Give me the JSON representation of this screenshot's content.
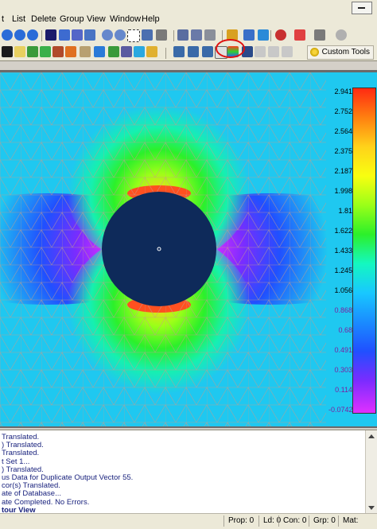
{
  "menu": {
    "items": [
      {
        "label": "t",
        "id": "t"
      },
      {
        "label": "List",
        "id": "list"
      },
      {
        "label": "Delete",
        "id": "delete"
      },
      {
        "label": "Group",
        "id": "group"
      },
      {
        "label": "View",
        "id": "view"
      },
      {
        "label": "Window",
        "id": "window"
      },
      {
        "label": "Help",
        "id": "help"
      }
    ]
  },
  "toolbar": {
    "custom_tools_label": "Custom Tools"
  },
  "legend": {
    "values": [
      "2.941",
      "2.752",
      "2.564",
      "2.375",
      "2.187",
      "1.998",
      "1.81",
      "1.622",
      "1.433",
      "1.245",
      "1.056",
      "0.868",
      "0.68",
      "0.491",
      "0.303",
      "0.114",
      "-0.0742"
    ]
  },
  "messages": [
    "Translated.",
    ") Translated.",
    "Translated.",
    "t Set 1...",
    ") Translated.",
    "us Data for Duplicate Output Vector 55.",
    "cor(s) Translated.",
    "ate of Database...",
    "ate Completed. No Errors.",
    "tour View"
  ],
  "status": {
    "prop": "Prop: 0",
    "ld": "Ld: 0",
    "con": "Con: 0",
    "grp": "Grp: 0",
    "mat": "Mat:"
  },
  "colors": {
    "background_field": "#1fc8f0",
    "hole": "#0e2a5a",
    "highlight_circle": "#e01010"
  }
}
